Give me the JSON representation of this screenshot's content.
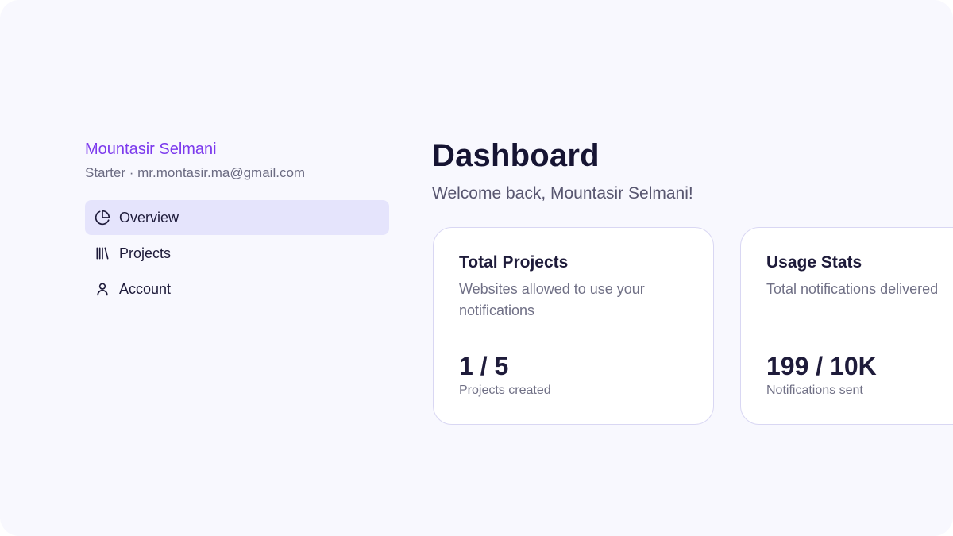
{
  "user": {
    "name": "Mountasir Selmani",
    "plan": "Starter",
    "separator": " · ",
    "email": "mr.montasir.ma@gmail.com"
  },
  "nav": {
    "items": [
      {
        "label": "Overview",
        "icon": "pie-chart-icon",
        "active": true
      },
      {
        "label": "Projects",
        "icon": "library-icon",
        "active": false
      },
      {
        "label": "Account",
        "icon": "user-icon",
        "active": false
      }
    ]
  },
  "main": {
    "title": "Dashboard",
    "subtitle": "Welcome back, Mountasir Selmani!"
  },
  "cards": [
    {
      "title": "Total Projects",
      "description": "Websites allowed to use your notifications",
      "value": "1 / 5",
      "caption": "Projects created"
    },
    {
      "title": "Usage Stats",
      "description": "Total notifications delivered",
      "value": "199 / 10K",
      "caption": "Notifications sent"
    }
  ],
  "colors": {
    "background": "#f8f8fe",
    "accent": "#7c3aed",
    "active_nav": "#e5e4fc",
    "card_border": "#d9d7f3",
    "text_primary": "#1e1b3a",
    "text_muted": "#707086"
  }
}
